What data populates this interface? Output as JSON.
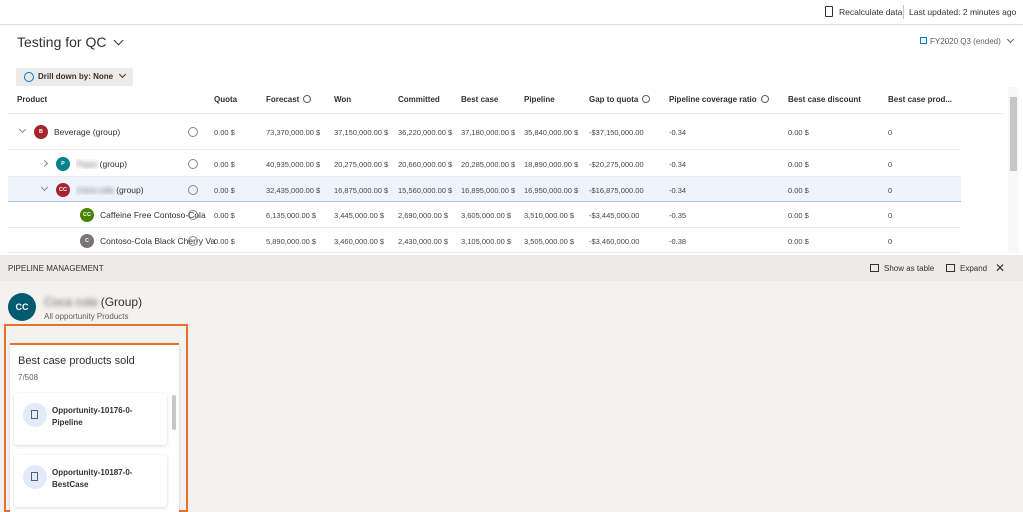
{
  "topbar": {
    "recalculate": "Recalculate data",
    "last_updated": "Last updated: 2 minutes ago"
  },
  "header": {
    "title": "Testing for QC",
    "period": "FY2020 Q3 (ended)",
    "drill_down": "Drill down by: None"
  },
  "table": {
    "columns": [
      "Product",
      "Quota",
      "Forecast",
      "Won",
      "Committed",
      "Best case",
      "Pipeline",
      "Gap to quota",
      "Pipeline coverage ratio",
      "Best case discount",
      "Best case prod..."
    ],
    "rows": [
      {
        "initials": "B",
        "color": "#a4262c",
        "name": "Beverage",
        "suffix": "(group)",
        "values": [
          "0.00 $",
          "73,370,000.00 $",
          "37,150,000.00 $",
          "36,220,000.00 $",
          "37,180,000.00 $",
          "35,840,000.00 $",
          "-$37,150,000.00",
          "-0.34",
          "0.00 $",
          "0"
        ]
      },
      {
        "initials": "P",
        "color": "#038387",
        "name": "Pepsi",
        "suffix": "(group)",
        "values": [
          "0.00 $",
          "40,935,000.00 $",
          "20,275,000.00 $",
          "20,660,000.00 $",
          "20,285,000.00 $",
          "18,890,000.00 $",
          "-$20,275,000.00",
          "-0.34",
          "0.00 $",
          "0"
        ]
      },
      {
        "initials": "CC",
        "color": "#a4262c",
        "name": "Coca cola",
        "suffix": "(group)",
        "values": [
          "0.00 $",
          "32,435,000.00 $",
          "16,875,000.00 $",
          "15,560,000.00 $",
          "16,895,000.00 $",
          "16,950,000.00 $",
          "-$16,875,000.00",
          "-0.34",
          "0.00 $",
          "0"
        ]
      },
      {
        "initials": "CC",
        "color": "#498205",
        "name": "Caffeine Free Contoso-Cola",
        "suffix": "",
        "values": [
          "0.00 $",
          "6,135,000.00 $",
          "3,445,000.00 $",
          "2,690,000.00 $",
          "3,605,000.00 $",
          "3,510,000.00 $",
          "-$3,445,000.00",
          "-0.35",
          "0.00 $",
          "0"
        ]
      },
      {
        "initials": "C",
        "color": "#7a7574",
        "name": "Contoso-Cola Black Cherry Va",
        "suffix": "",
        "values": [
          "0.00 $",
          "5,890,000.00 $",
          "3,460,000.00 $",
          "2,430,000.00 $",
          "3,105,000.00 $",
          "3,505,000.00 $",
          "-$3,460,000.00",
          "-0.38",
          "0.00 $",
          "0"
        ]
      }
    ]
  },
  "panel": {
    "title": "PIPELINE MANAGEMENT",
    "show_as_table": "Show as table",
    "expand": "Expand",
    "entity": {
      "initials": "CC",
      "name": "Coca cola",
      "suffix": "(Group)",
      "subtitle": "All opportunity Products"
    },
    "card": {
      "title": "Best case products sold",
      "count": "7/508",
      "items": [
        {
          "line1": "Opportunity-10176-0-",
          "line2": "Pipeline"
        },
        {
          "line1": "Opportunity-10187-0-",
          "line2": "BestCase"
        }
      ]
    }
  }
}
